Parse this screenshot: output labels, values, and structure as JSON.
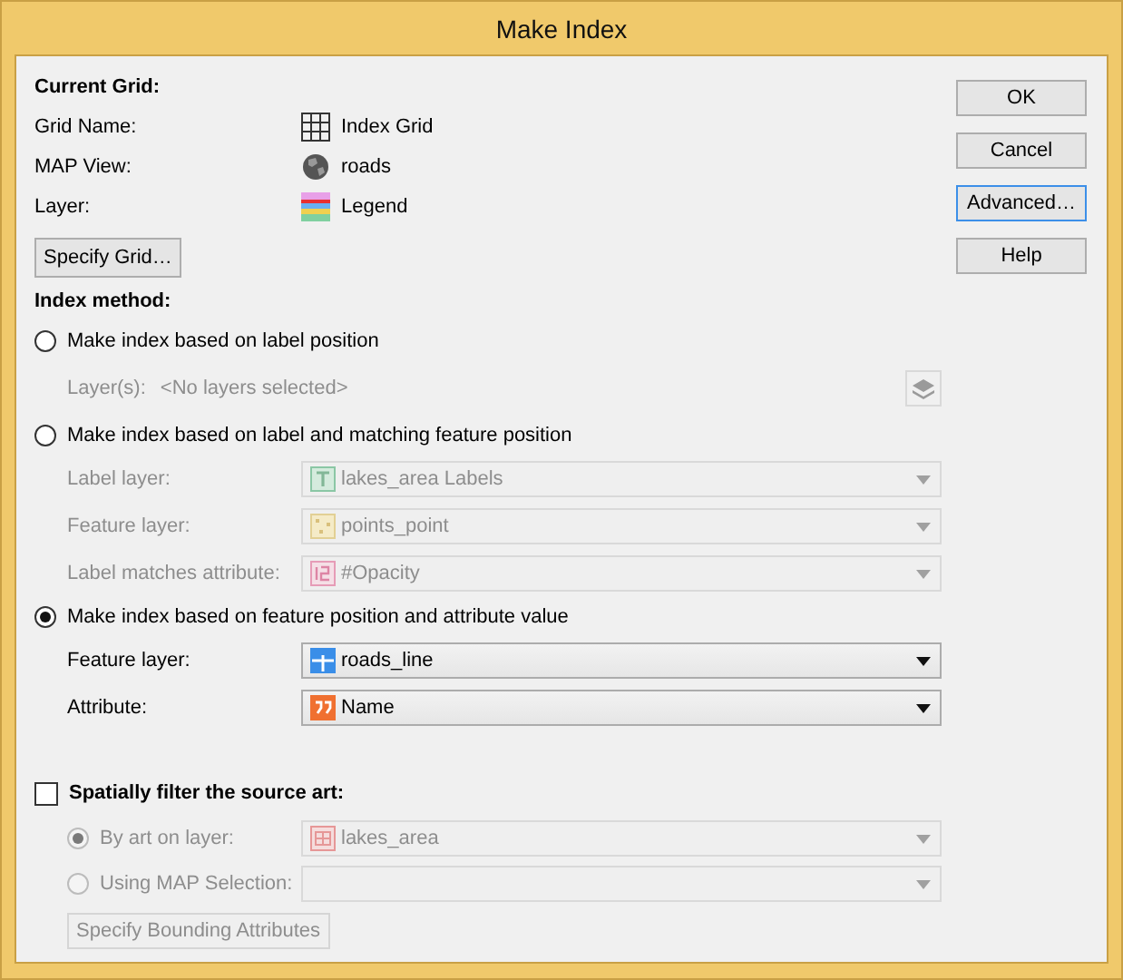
{
  "window": {
    "title": "Make Index"
  },
  "current_grid": {
    "heading": "Current Grid:",
    "fields": [
      {
        "label": "Grid Name:",
        "value": "Index Grid",
        "kind": "grid"
      },
      {
        "label": "MAP View:",
        "value": "roads",
        "kind": "globe"
      },
      {
        "label": "Layer:",
        "value": "Legend",
        "kind": "legend"
      }
    ],
    "button": "Specify Grid…"
  },
  "index_method": {
    "heading": "Index method:",
    "options": [
      {
        "label": "Make index based on label position",
        "selected": false,
        "rows": [
          {
            "kind": "layers",
            "label": "Layer(s):",
            "value": "<No layers selected>",
            "disabled": true
          }
        ]
      },
      {
        "label": "Make index based on label and matching feature position",
        "selected": false,
        "rows": [
          {
            "kind": "text",
            "label": "Label layer:",
            "value": "lakes_area Labels",
            "disabled": true
          },
          {
            "kind": "point",
            "label": "Feature layer:",
            "value": "points_point",
            "disabled": true
          },
          {
            "kind": "number",
            "label": "Label matches attribute:",
            "value": "#Opacity",
            "disabled": true
          }
        ]
      },
      {
        "label": "Make index based on feature position and attribute value",
        "selected": true,
        "rows": [
          {
            "kind": "line",
            "label": "Feature layer:",
            "value": "roads_line",
            "disabled": false
          },
          {
            "kind": "string",
            "label": "Attribute:",
            "value": "Name",
            "disabled": false
          }
        ]
      }
    ]
  },
  "spatial_filter": {
    "label": "Spatially filter the source art:",
    "checked": false,
    "disabled": true,
    "options": [
      {
        "label": "By art on layer:",
        "selected": true,
        "value": "lakes_area",
        "kind": "area"
      },
      {
        "label": "Using MAP Selection:",
        "selected": false
      }
    ],
    "button": "Specify Bounding Attributes"
  },
  "buttons": [
    {
      "label": "OK",
      "focused": false
    },
    {
      "label": "Cancel",
      "focused": false
    },
    {
      "label": "Advanced…",
      "focused": true
    },
    {
      "label": "Help",
      "focused": false
    }
  ]
}
